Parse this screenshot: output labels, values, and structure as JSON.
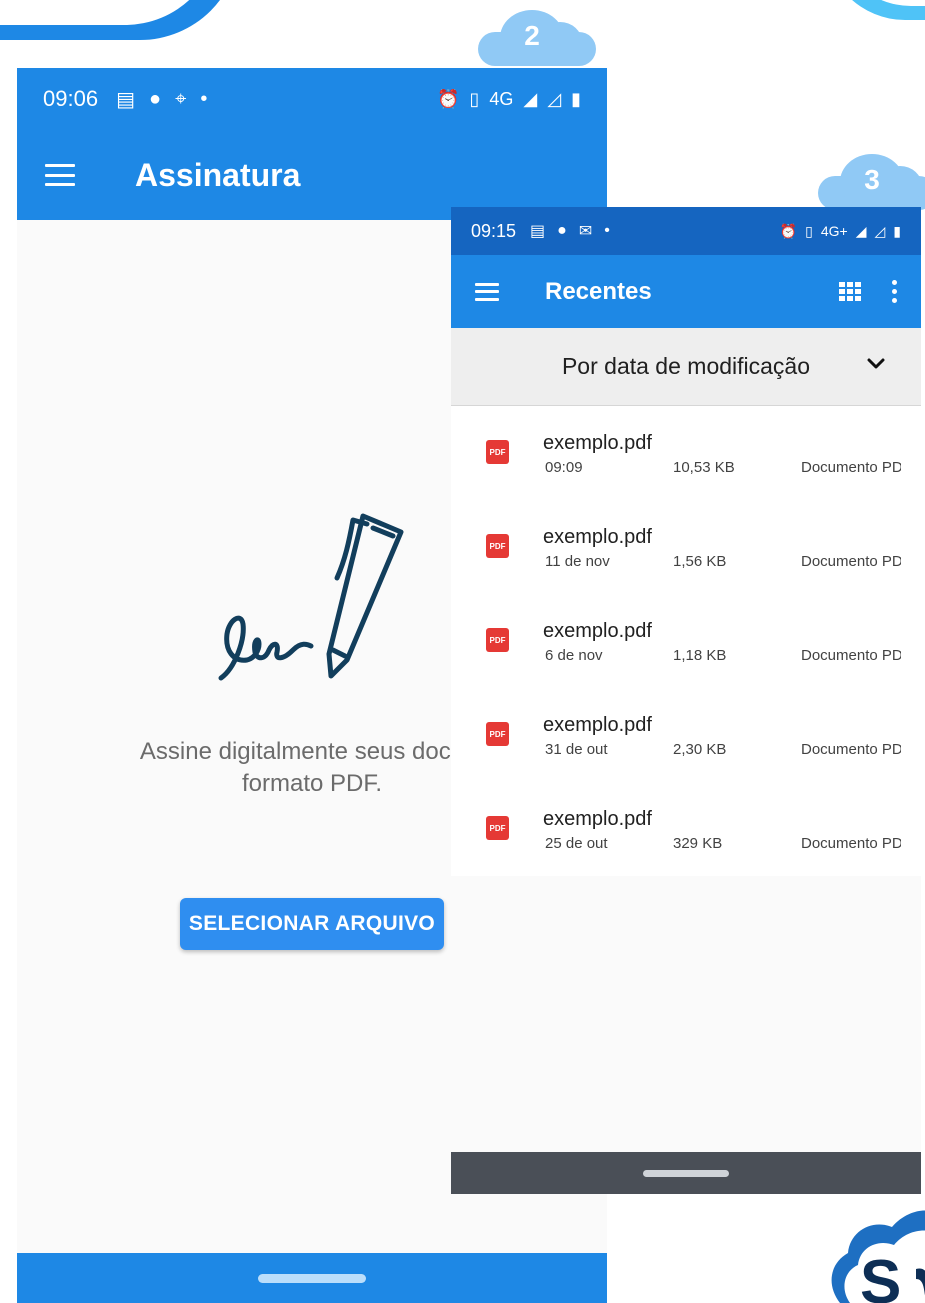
{
  "badges": {
    "step2": "2",
    "step3": "3"
  },
  "phone1": {
    "status": {
      "time": "09:06",
      "network": "4G"
    },
    "app_title": "Assinatura",
    "description_line1": "Assine digitalmente seus docum",
    "description_line2": "formato PDF.",
    "select_button": "SELECIONAR ARQUIVO"
  },
  "phone2": {
    "status": {
      "time": "09:15",
      "network": "4G+"
    },
    "app_title": "Recentes",
    "sort_label": "Por data de modificação",
    "files": [
      {
        "icon": "PDF",
        "name": "exemplo.pdf",
        "date": "09:09",
        "size": "10,53 KB",
        "type": "Documento PDF"
      },
      {
        "icon": "PDF",
        "name": "exemplo.pdf",
        "date": "11 de nov",
        "size": "1,56 KB",
        "type": "Documento PDF"
      },
      {
        "icon": "PDF",
        "name": "exemplo.pdf",
        "date": "6 de nov",
        "size": "1,18 KB",
        "type": "Documento PDF"
      },
      {
        "icon": "PDF",
        "name": "exemplo.pdf",
        "date": "31 de out",
        "size": "2,30 KB",
        "type": "Documento PDF"
      },
      {
        "icon": "PDF",
        "name": "exemplo.pdf",
        "date": "25 de out",
        "size": "329 KB",
        "type": "Documento PDF"
      }
    ]
  },
  "colors": {
    "app_blue": "#1e88e5",
    "status_dark_blue": "#1565c0",
    "button_blue": "#2f8ef0",
    "pdf_red": "#e53935",
    "cloud": "#90c9f5"
  }
}
